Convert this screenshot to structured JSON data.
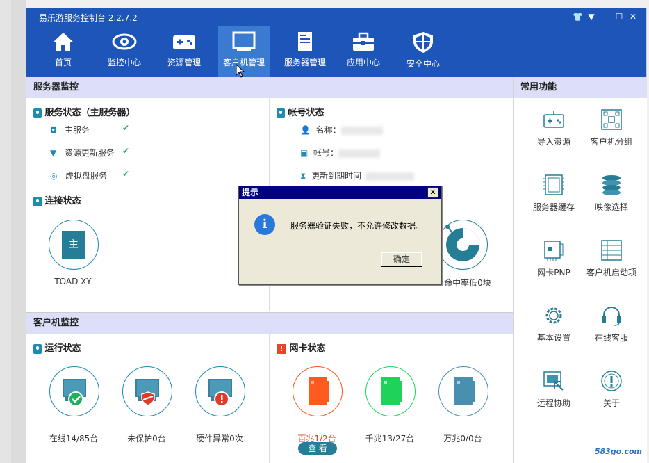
{
  "app": {
    "title": "易乐游服务控制台 2.2.7.2"
  },
  "nav": [
    {
      "label": "首页",
      "icon": "home-icon"
    },
    {
      "label": "监控中心",
      "icon": "eye-icon"
    },
    {
      "label": "资源管理",
      "icon": "gamepad-icon"
    },
    {
      "label": "客户机管理",
      "icon": "monitor-icon",
      "active": true
    },
    {
      "label": "服务器管理",
      "icon": "server-icon"
    },
    {
      "label": "应用中心",
      "icon": "toolbox-icon"
    },
    {
      "label": "安全中心",
      "icon": "shield-icon"
    }
  ],
  "server_monitor": {
    "header": "服务器监控",
    "service_status": {
      "title": "服务状态（主服务器）",
      "items": [
        "主服务",
        "资源更新服务",
        "虚拟盘服务"
      ]
    },
    "account_status": {
      "title": "帐号状态",
      "items": [
        "名称：",
        "帐号：",
        "更新到期时间"
      ]
    },
    "connection_status": {
      "title": "连接状态",
      "server_label": "TOAD-XY",
      "server_glyph": "主",
      "partial_labels": [
        "命中率低0块"
      ]
    }
  },
  "client_monitor": {
    "header": "客户机监控",
    "run_status": {
      "title": "运行状态",
      "items": [
        "在线14/85台",
        "未保护0台",
        "硬件异常0次"
      ]
    },
    "nic_status": {
      "title": "网卡状态",
      "items": [
        {
          "label": "百兆1/2台",
          "color": "#ff5a1f"
        },
        {
          "label": "千兆13/27台",
          "color": "#1fd35a"
        },
        {
          "label": "万兆0/0台",
          "color": "#4a8fb0"
        }
      ],
      "view_button": "查 看"
    }
  },
  "common_functions": {
    "header": "常用功能",
    "items": [
      {
        "label": "导入资源",
        "icon": "gamepad-icon"
      },
      {
        "label": "客户机分组",
        "icon": "group-icon"
      },
      {
        "label": "服务器缓存",
        "icon": "memory-icon"
      },
      {
        "label": "映像选择",
        "icon": "disk-stack-icon"
      },
      {
        "label": "网卡PNP",
        "icon": "network-card-icon"
      },
      {
        "label": "客户机启动项",
        "icon": "list-icon"
      },
      {
        "label": "基本设置",
        "icon": "gear-icon"
      },
      {
        "label": "在线客服",
        "icon": "headset-icon"
      },
      {
        "label": "远程协助",
        "icon": "remote-icon"
      },
      {
        "label": "关于",
        "icon": "info-icon"
      }
    ]
  },
  "dialog": {
    "title": "提示",
    "message": "服务器验证失败，不允许修改数据。",
    "ok": "确定",
    "close": "✕"
  },
  "watermark": "583go.com"
}
